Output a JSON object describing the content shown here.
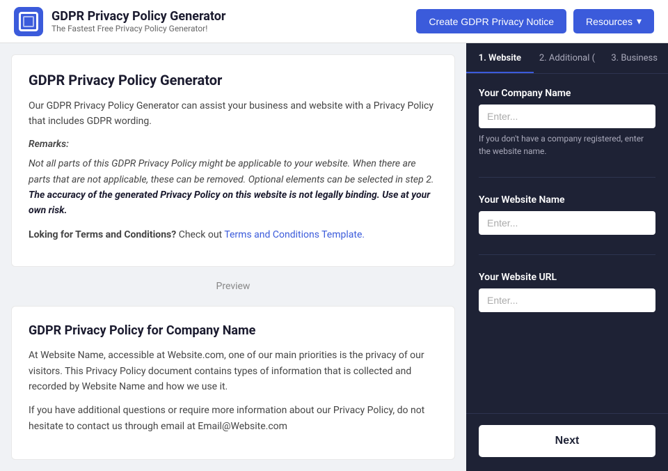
{
  "header": {
    "logo_alt": "GDPR Privacy Policy Generator Logo",
    "title": "GDPR Privacy Policy Generator",
    "subtitle": "The Fastest Free Privacy Policy Generator!",
    "create_btn": "Create GDPR Privacy Notice",
    "resources_btn": "Resources",
    "resources_chevron": "▾"
  },
  "intro_card": {
    "title": "GDPR Privacy Policy Generator",
    "description": "Our GDPR Privacy Policy Generator can assist your business and website with a Privacy Policy that includes GDPR wording.",
    "remarks_label": "Remarks:",
    "italic_text": "Not all parts of this GDPR Privacy Policy might be applicable to your website. When there are parts that are not applicable, these can be removed. Optional elements can be selected in step 2.",
    "bold_warning": "The accuracy of the generated Privacy Policy on this website is not legally binding. Use at your own risk.",
    "terms_prefix": "Loking for Terms and Conditions?",
    "terms_check": " Check out ",
    "terms_link_text": "Terms and Conditions Template.",
    "terms_link_href": "#"
  },
  "preview_label": "Preview",
  "preview_card": {
    "title": "GDPR Privacy Policy for Company Name",
    "para1": "At Website Name, accessible at Website.com, one of our main priorities is the privacy of our visitors. This Privacy Policy document contains types of information that is collected and recorded by Website Name and how we use it.",
    "para2": "If you have additional questions or require more information about our Privacy Policy, do not hesitate to contact us through email at Email@Website.com"
  },
  "sidebar": {
    "steps": [
      {
        "number": "1",
        "label": "Website",
        "active": true
      },
      {
        "number": "2",
        "label": "Additional (",
        "active": false
      },
      {
        "number": "3",
        "label": "Business",
        "active": false
      }
    ],
    "step1_label": "1. Website",
    "step2_label": "2. Additional (",
    "step3_label": "3. Business",
    "fields": {
      "company_name_label": "Your Company Name",
      "company_name_placeholder": "Enter...",
      "company_name_hint": "If you don't have a company registered, enter the website name.",
      "website_name_label": "Your Website Name",
      "website_name_placeholder": "Enter...",
      "website_url_label": "Your Website URL",
      "website_url_placeholder": "Enter..."
    },
    "next_btn": "Next"
  }
}
